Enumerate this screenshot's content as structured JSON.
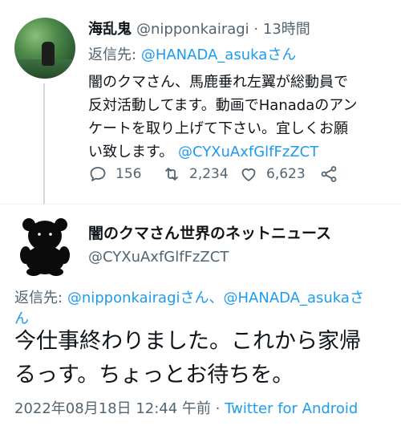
{
  "tweet1": {
    "display_name": "海乱鬼",
    "handle": "@nipponkairagi",
    "separator": "·",
    "time": "13時間",
    "reply_prefix": "返信先:",
    "reply_to": "@HANADA_asukaさん",
    "body_lines": [
      "闇のクマさん、馬鹿垂れ左翼が総動員で",
      "反対活動してます。動画でHanadaのアン",
      "ケートを取り上げて下さい。宜しくお願",
      "い致します。"
    ],
    "mention": "@CYXuAxfGlfFzZCT",
    "reply_count": "156",
    "retweet_count": "2,234",
    "like_count": "6,623"
  },
  "tweet2": {
    "display_name": "闇のクマさん世界のネットニュース",
    "handle": "@CYXuAxfGlfFzZCT",
    "reply_prefix": "返信先:",
    "reply_to_1": "@nipponkairagiさん、",
    "reply_to_2": "@HANADA_asukaさ",
    "reply_to_3": "ん",
    "body_lines": [
      "今仕事終わりました。これから家帰",
      "るっす。ちょっとお待ちを。"
    ],
    "timestamp": "2022年08月18日 12:44 午前",
    "separator": "·",
    "source": "Twitter for Android"
  },
  "icons": {
    "reply": "reply-icon",
    "retweet": "retweet-icon",
    "like": "like-icon",
    "share": "share-icon",
    "avatar2": "bear-silhouette-avatar"
  },
  "colors": {
    "link": "#1d9bf0",
    "muted": "#536471",
    "text": "#0f1419",
    "thread_line": "#cfd9de"
  }
}
